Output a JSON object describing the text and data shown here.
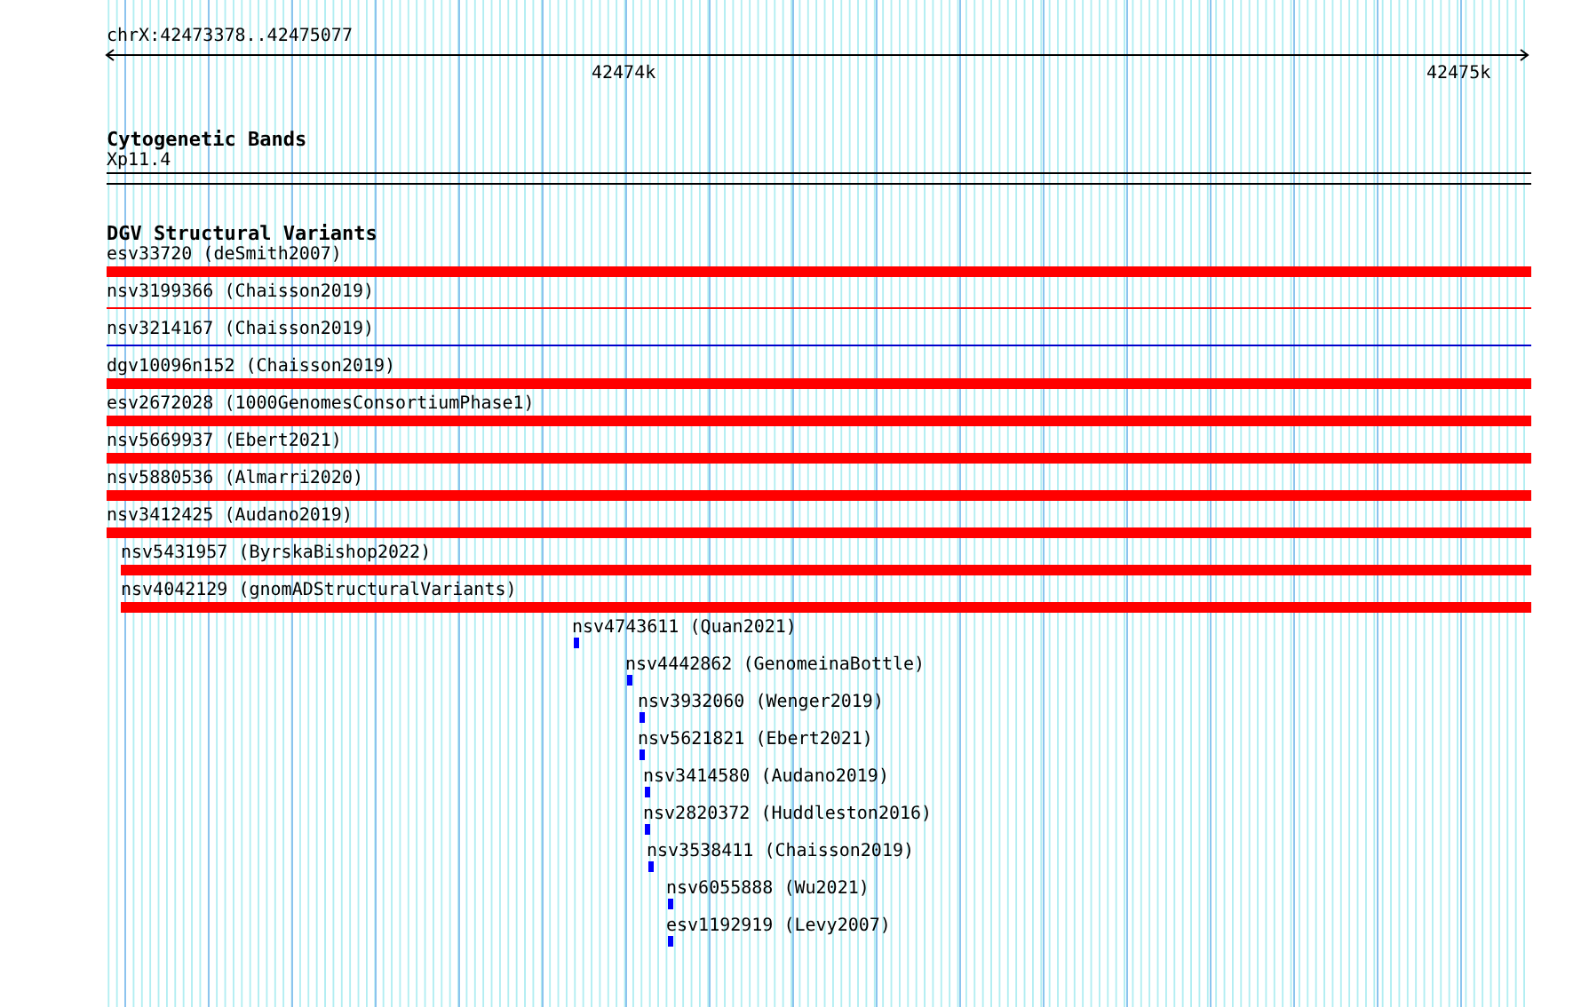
{
  "ruler": {
    "location": "chrX:42473378..42475077",
    "ticks": [
      {
        "label": "42474k"
      },
      {
        "label": "42475k"
      }
    ]
  },
  "cytoband_track": {
    "title": "Cytogenetic Bands",
    "band": "Xp11.4"
  },
  "variant_track": {
    "title": "DGV Structural Variants",
    "features": [
      {
        "label": "esv33720 (deSmith2007)",
        "kind": "thick",
        "color": "#ff0000"
      },
      {
        "label": "nsv3199366 (Chaisson2019)",
        "kind": "thin",
        "color": "#ff0000"
      },
      {
        "label": "nsv3214167 (Chaisson2019)",
        "kind": "thin",
        "color": "#0000cc"
      },
      {
        "label": "dgv10096n152 (Chaisson2019)",
        "kind": "thick",
        "color": "#ff0000"
      },
      {
        "label": "esv2672028 (1000GenomesConsortiumPhase1)",
        "kind": "thick",
        "color": "#ff0000"
      },
      {
        "label": "nsv5669937 (Ebert2021)",
        "kind": "thick",
        "color": "#ff0000"
      },
      {
        "label": "nsv5880536 (Almarri2020)",
        "kind": "thick",
        "color": "#ff0000"
      },
      {
        "label": "nsv3412425 (Audano2019)",
        "kind": "thick",
        "color": "#ff0000"
      },
      {
        "label": "nsv5431957 (ByrskaBishop2022)",
        "kind": "thick",
        "color": "#ff0000"
      },
      {
        "label": "nsv4042129 (gnomADStructuralVariants)",
        "kind": "thick",
        "color": "#ff0000"
      },
      {
        "label": "nsv4743611 (Quan2021)",
        "kind": "small",
        "color": "#0000ff"
      },
      {
        "label": "nsv4442862 (GenomeinaBottle)",
        "kind": "small",
        "color": "#0000ff"
      },
      {
        "label": "nsv3932060 (Wenger2019)",
        "kind": "small",
        "color": "#0000ff"
      },
      {
        "label": "nsv5621821 (Ebert2021)",
        "kind": "small",
        "color": "#0000ff"
      },
      {
        "label": "nsv3414580 (Audano2019)",
        "kind": "small",
        "color": "#0000ff"
      },
      {
        "label": "nsv2820372 (Huddleston2016)",
        "kind": "small",
        "color": "#0000ff"
      },
      {
        "label": "nsv3538411 (Chaisson2019)",
        "kind": "small",
        "color": "#0000ff"
      },
      {
        "label": "nsv6055888 (Wu2021)",
        "kind": "small",
        "color": "#0000ff"
      },
      {
        "label": "esv1192919 (Levy2007)",
        "kind": "small",
        "color": "#0000ff"
      }
    ]
  }
}
